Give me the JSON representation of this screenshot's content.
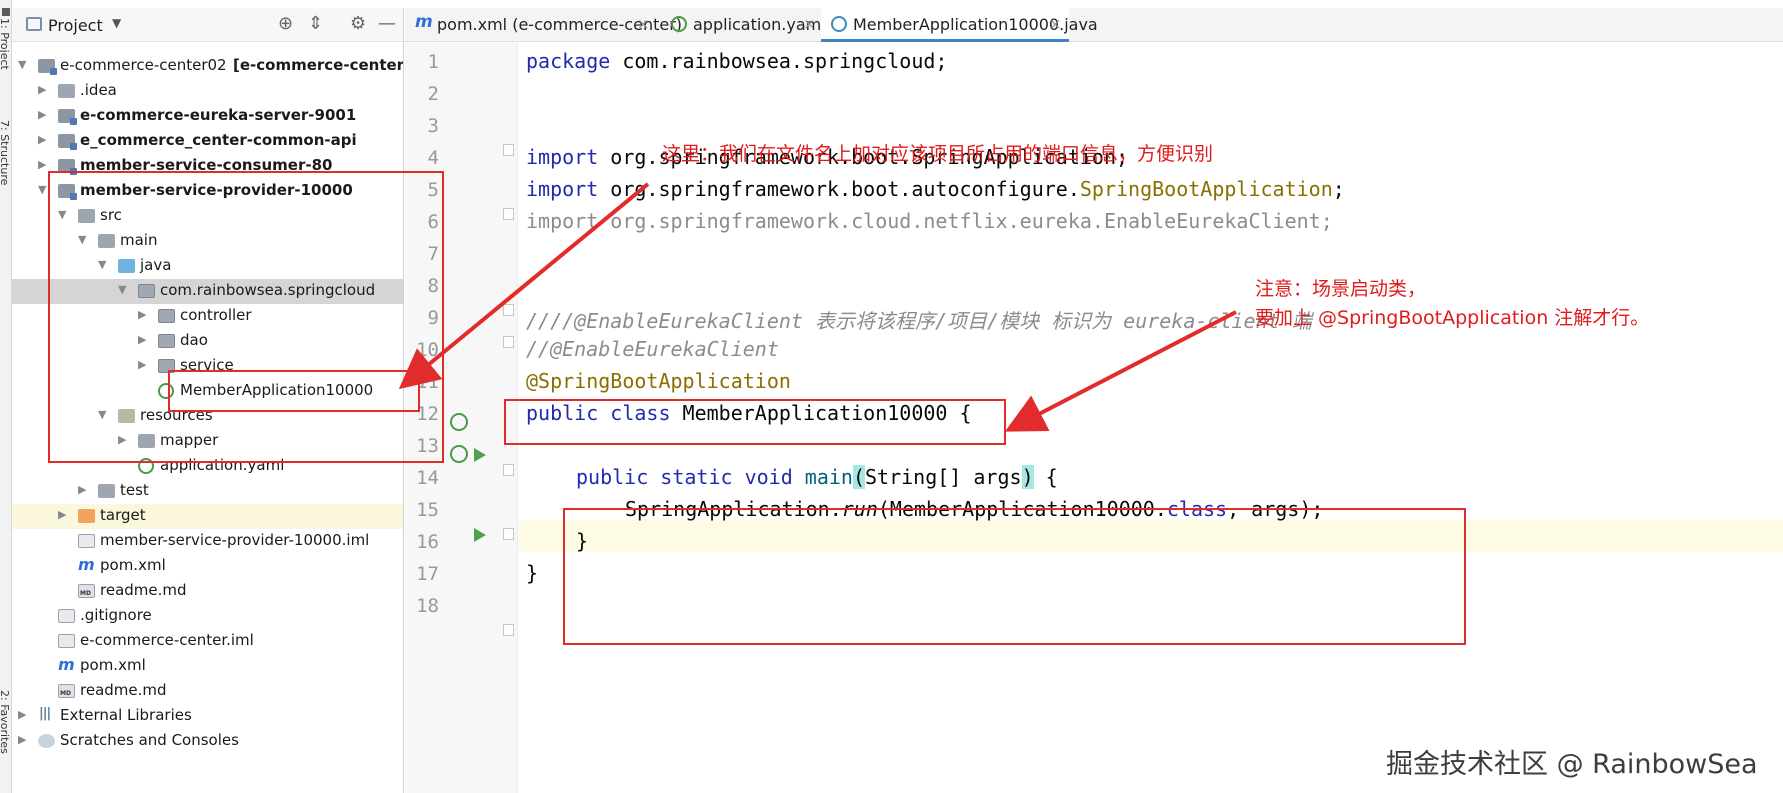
{
  "tool_strip": {
    "project_label": "1: Project",
    "structure_label": "7: Structure",
    "favorites_label": "2: Favorites"
  },
  "project_pane": {
    "title": "Project",
    "icons": [
      "locate-icon",
      "collapse-icon",
      "settings-icon",
      "hide-icon"
    ]
  },
  "tree": [
    {
      "label": "e-commerce-center02",
      "suffix": "[e-commerce-center]",
      "icon": "module",
      "depth": 0,
      "arrow": "▼",
      "bold": false
    },
    {
      "label": ".idea",
      "icon": "folder",
      "depth": 1,
      "arrow": "▶",
      "bold": false
    },
    {
      "label": "e-commerce-eureka-server-9001",
      "icon": "module",
      "depth": 1,
      "arrow": "▶",
      "bold": true
    },
    {
      "label": "e_commerce_center-common-api",
      "icon": "module",
      "depth": 1,
      "arrow": "▶",
      "bold": true
    },
    {
      "label": "member-service-consumer-80",
      "icon": "module",
      "depth": 1,
      "arrow": "▶",
      "bold": true
    },
    {
      "label": "member-service-provider-10000",
      "icon": "module",
      "depth": 1,
      "arrow": "▼",
      "bold": true
    },
    {
      "label": "src",
      "icon": "src",
      "depth": 2,
      "arrow": "▼",
      "bold": false
    },
    {
      "label": "main",
      "icon": "folder",
      "depth": 3,
      "arrow": "▼",
      "bold": false
    },
    {
      "label": "java",
      "icon": "java",
      "depth": 4,
      "arrow": "▼",
      "bold": false
    },
    {
      "label": "com.rainbowsea.springcloud",
      "icon": "pkg",
      "depth": 5,
      "arrow": "▼",
      "bold": false,
      "selected": true
    },
    {
      "label": "controller",
      "icon": "pkg",
      "depth": 6,
      "arrow": "▶",
      "bold": false
    },
    {
      "label": "dao",
      "icon": "pkg",
      "depth": 6,
      "arrow": "▶",
      "bold": false
    },
    {
      "label": "service",
      "icon": "pkg",
      "depth": 6,
      "arrow": "▶",
      "bold": false
    },
    {
      "label": "MemberApplication10000",
      "icon": "spring",
      "depth": 6,
      "arrow": "",
      "bold": false
    },
    {
      "label": "resources",
      "icon": "res",
      "depth": 4,
      "arrow": "▼",
      "bold": false
    },
    {
      "label": "mapper",
      "icon": "folder",
      "depth": 5,
      "arrow": "▶",
      "bold": false
    },
    {
      "label": "application.yaml",
      "icon": "yaml",
      "depth": 5,
      "arrow": "",
      "bold": false
    },
    {
      "label": "test",
      "icon": "folder",
      "depth": 3,
      "arrow": "▶",
      "bold": false
    },
    {
      "label": "target",
      "icon": "target",
      "depth": 2,
      "arrow": "▶",
      "bold": false,
      "highlight": true
    },
    {
      "label": "member-service-provider-10000.iml",
      "icon": "iml",
      "depth": 2,
      "arrow": "",
      "bold": false
    },
    {
      "label": "pom.xml",
      "icon": "maven",
      "depth": 2,
      "arrow": "",
      "bold": false
    },
    {
      "label": "readme.md",
      "icon": "md",
      "depth": 2,
      "arrow": "",
      "bold": false
    },
    {
      "label": ".gitignore",
      "icon": "git",
      "depth": 1,
      "arrow": "",
      "bold": false
    },
    {
      "label": "e-commerce-center.iml",
      "icon": "iml",
      "depth": 1,
      "arrow": "",
      "bold": false
    },
    {
      "label": "pom.xml",
      "icon": "maven",
      "depth": 1,
      "arrow": "",
      "bold": false
    },
    {
      "label": "readme.md",
      "icon": "md",
      "depth": 1,
      "arrow": "",
      "bold": false
    },
    {
      "label": "External Libraries",
      "icon": "libs",
      "depth": 0,
      "arrow": "▶",
      "bold": false
    },
    {
      "label": "Scratches and Consoles",
      "icon": "scratch",
      "depth": 0,
      "arrow": "▶",
      "bold": false
    }
  ],
  "tabs": [
    {
      "label": "pom.xml (e-commerce-center)",
      "icon": "m",
      "active": false
    },
    {
      "label": "application.yaml",
      "icon": "yml",
      "active": false
    },
    {
      "label": "MemberApplication10000.java",
      "icon": "jv",
      "active": true
    }
  ],
  "code": {
    "line_numbers": [
      "1",
      "2",
      "3",
      "4",
      "5",
      "6",
      "7",
      "8",
      "9",
      "10",
      "11",
      "12",
      "13",
      "14",
      "15",
      "16",
      "17",
      "18"
    ],
    "l1_kw": "package",
    "l1_rest": " com.rainbowsea.springcloud;",
    "l4_kw": "import",
    "l4_rest": " org.springframework.boot.SpringApplication;",
    "l5_kw": "import",
    "l5_mid": " org.springframework.boot.autoconfigure.",
    "l5_ann": "SpringBootApplication",
    "l5_end": ";",
    "l6_text": "import org.springframework.cloud.netflix.eureka.EnableEurekaClient;",
    "l9_text": "////@EnableEurekaClient 表示将该程序/项目/模块 标识为 eureka-client 端",
    "l10_text": "//@EnableEurekaClient",
    "l11_text": "@SpringBootApplication",
    "l12_kw": "public class",
    "l12_rest": " MemberApplication10000 {",
    "l14_kw": "public static void",
    "l14_fn": "main",
    "l14_open": "(",
    "l14_args": "String[] args",
    "l14_close": ")",
    "l14_end": " {",
    "l15_pre": "SpringApplication.",
    "l15_run": "run",
    "l15_mid": "(MemberApplication10000.",
    "l15_class": "class",
    "l15_end": ", args);",
    "l16_text": "}",
    "l17_text": "}"
  },
  "annotations": {
    "note1": "这里：我们在文件名上加对应该项目所占用的端口信息，方便识别",
    "note2_line1": "注意：场景启动类，",
    "note2_line2": "要加上 @SpringBootApplication 注解才行。",
    "watermark": "掘金技术社区 @ RainbowSea",
    "color": "#e22b2b"
  }
}
